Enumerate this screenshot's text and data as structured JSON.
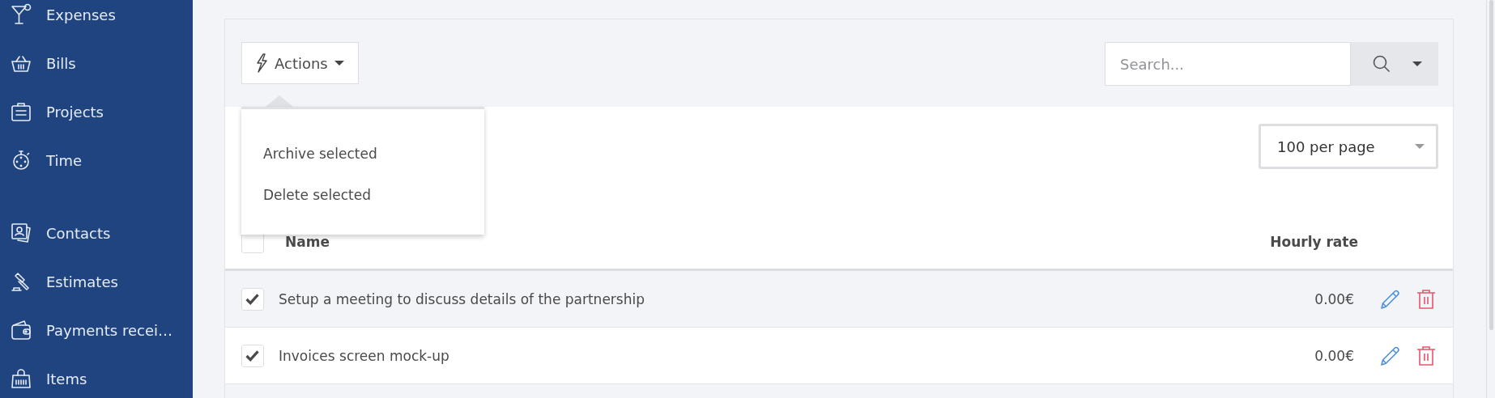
{
  "sidebar": {
    "sections": [
      {
        "items": [
          {
            "label": "Expenses",
            "kind": "glass"
          },
          {
            "label": "Bills",
            "kind": "basket"
          },
          {
            "label": "Projects",
            "kind": "briefcase"
          },
          {
            "label": "Time",
            "kind": "stopwatch"
          }
        ]
      },
      {
        "items": [
          {
            "label": "Contacts",
            "kind": "contacts"
          },
          {
            "label": "Estimates",
            "kind": "gavel"
          },
          {
            "label": "Payments recei…",
            "kind": "wallet"
          },
          {
            "label": "Items",
            "kind": "shop"
          }
        ]
      }
    ]
  },
  "toolbar": {
    "actions_button": {
      "label": "Actions",
      "menu": [
        "Archive selected",
        "Delete selected"
      ]
    },
    "search": {
      "placeholder": "Search..."
    }
  },
  "per_page": {
    "value": "100 per page"
  },
  "table": {
    "columns": [
      "Name",
      "Hourly rate"
    ],
    "all_checked": false,
    "rows": [
      {
        "name": "Setup a meeting to discuss details of the partnership",
        "rate": "0.00€",
        "checked": true
      },
      {
        "name": "Invoices screen mock-up",
        "rate": "0.00€",
        "checked": true
      }
    ]
  }
}
